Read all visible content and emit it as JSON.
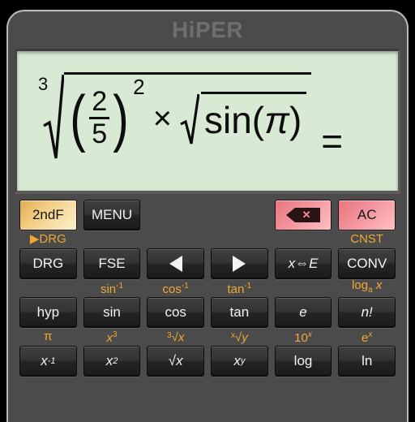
{
  "app": {
    "title": "HiPER",
    "display_colors": {
      "screen_bg": "#d9ead4",
      "panel_bg": "#4b4b4b",
      "alt_label": "#f0a830",
      "second_function_key": "#f3cf86",
      "clear_key": "#f1909a"
    }
  },
  "display": {
    "expression_text": "3√((2/5)² × √sin(π)) =",
    "radical_index": "3",
    "fraction_numerator": "2",
    "fraction_denominator": "5",
    "power_exponent": "2",
    "multiply_symbol": "×",
    "inner_function": "sin",
    "inner_argument": "π",
    "open_paren": "(",
    "close_paren": ")",
    "equals": "="
  },
  "keypad": {
    "row_modes": {
      "second_function": "2ndF",
      "menu": "MENU",
      "backspace_icon": "backspace-icon",
      "backspace_glyph": "✕",
      "all_clear": "AC"
    },
    "alt_labels_row1": {
      "drg_alt": "▶DRG",
      "cnst_alt": "CNST"
    },
    "row_functions": [
      {
        "label": "DRG",
        "alt": ""
      },
      {
        "label": "FSE",
        "alt": "sin"
      },
      {
        "label": "◀",
        "alt": "cos",
        "icon": "arrow-left-icon"
      },
      {
        "label": "▶",
        "alt": "tan",
        "icon": "arrow-right-icon"
      },
      {
        "label": "x⇔E",
        "alt": ""
      },
      {
        "label": "CONV",
        "alt": "log"
      }
    ],
    "alt_labels_row2": [
      {
        "base": "",
        "sup": ""
      },
      {
        "base": "sin",
        "sup": "-1"
      },
      {
        "base": "cos",
        "sup": "-1"
      },
      {
        "base": "tan",
        "sup": "-1"
      },
      {
        "base": "",
        "sup": ""
      },
      {
        "base": "log",
        "sub": "a",
        "after": " x"
      }
    ],
    "row_trig": [
      {
        "label": "hyp"
      },
      {
        "label": "sin"
      },
      {
        "label": "cos"
      },
      {
        "label": "tan"
      },
      {
        "label": "e",
        "italic": true
      },
      {
        "label": "n!",
        "italic": true
      }
    ],
    "alt_labels_row3": [
      {
        "text": "π"
      },
      {
        "base": "x",
        "sup": "3"
      },
      {
        "pre": "3",
        "text": "√x"
      },
      {
        "pre": "x",
        "text": "√y"
      },
      {
        "base": "10",
        "sup": "x"
      },
      {
        "base": "e",
        "sup": "x"
      }
    ],
    "row_power": [
      {
        "base": "x",
        "sup": "-1"
      },
      {
        "base": "x",
        "sup": "2"
      },
      {
        "text": "√x"
      },
      {
        "base": "x",
        "sup": "y"
      },
      {
        "text": "log"
      },
      {
        "text": "ln"
      }
    ]
  }
}
